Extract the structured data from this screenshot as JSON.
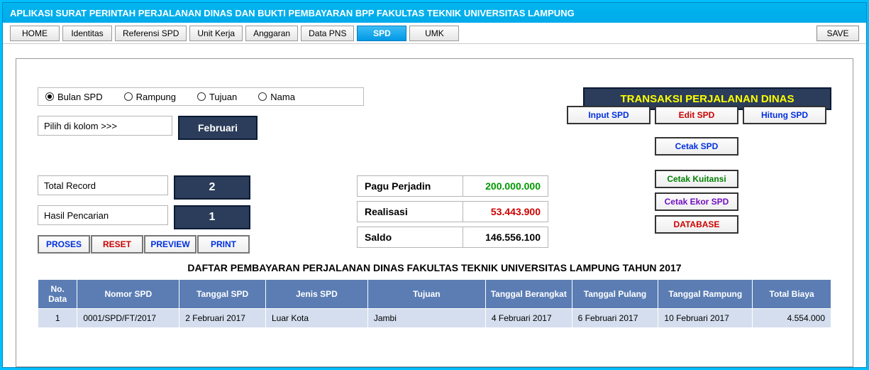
{
  "app": {
    "title": "APLIKASI SURAT PERINTAH PERJALANAN DINAS DAN BUKTI PEMBAYARAN BPP FAKULTAS TEKNIK UNIVERSITAS LAMPUNG"
  },
  "menu": {
    "home": "HOME",
    "identitas": "Identitas",
    "referensi": "Referensi SPD",
    "unitkerja": "Unit Kerja",
    "anggaran": "Anggaran",
    "datapns": "Data PNS",
    "spd": "SPD",
    "umk": "UMK",
    "save": "SAVE"
  },
  "filter": {
    "bulan": "Bulan SPD",
    "rampung": "Rampung",
    "tujuan": "Tujuan",
    "nama": "Nama",
    "hint": "Pilih di kolom >>>",
    "month": "Februari"
  },
  "banner": "TRANSAKSI PERJALANAN DINAS",
  "stats": {
    "total_label": "Total Record",
    "total_val": "2",
    "hasil_label": "Hasil Pencarian",
    "hasil_val": "1"
  },
  "fin": {
    "pagu_label": "Pagu Perjadin",
    "pagu_val": "200.000.000",
    "realisasi_label": "Realisasi",
    "realisasi_val": "53.443.900",
    "saldo_label": "Saldo",
    "saldo_val": "146.556.100"
  },
  "btnleft": {
    "proses": "PROSES",
    "reset": "RESET",
    "preview": "PREVIEW",
    "print": "PRINT"
  },
  "btnright": {
    "input": "Input SPD",
    "edit": "Edit SPD",
    "hitung": "Hitung SPD",
    "cetak_spd": "Cetak SPD",
    "cetak_kuitansi": "Cetak Kuitansi",
    "cetak_ekor": "Cetak Ekor SPD",
    "database": "DATABASE"
  },
  "table": {
    "title": "DAFTAR PEMBAYARAN PERJALANAN DINAS FAKULTAS TEKNIK UNIVERSITAS LAMPUNG TAHUN 2017",
    "headers": {
      "no": "No. Data",
      "nomor": "Nomor SPD",
      "tgl_spd": "Tanggal SPD",
      "jenis": "Jenis SPD",
      "tujuan": "Tujuan",
      "tgl_berangkat": "Tanggal Berangkat",
      "tgl_pulang": "Tanggal Pulang",
      "tgl_rampung": "Tanggal Rampung",
      "total": "Total Biaya"
    },
    "row": {
      "no": "1",
      "nomor": "0001/SPD/FT/2017",
      "tgl_spd": "2 Februari 2017",
      "jenis": "Luar Kota",
      "tujuan": "Jambi",
      "tgl_berangkat": "4 Februari 2017",
      "tgl_pulang": "6 Februari 2017",
      "tgl_rampung": "10 Februari 2017",
      "total": "4.554.000"
    }
  }
}
